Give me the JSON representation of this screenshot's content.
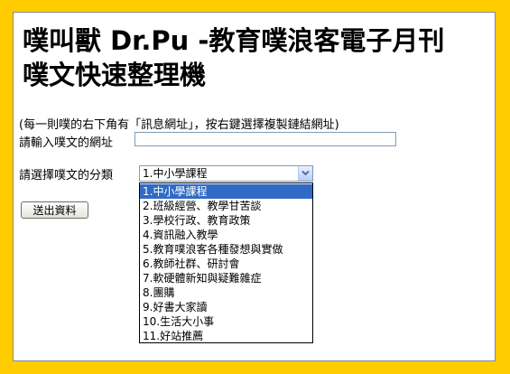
{
  "title": {
    "line1": "噗叫獸 Dr.Pu -教育噗浪客電子月刊",
    "line2": "噗文快速整理機"
  },
  "hint": "(每一則噗的右下角有「訊息網址」，按右鍵選擇複製鏈結網址)",
  "url_field": {
    "label": "請輸入噗文的網址",
    "value": ""
  },
  "category": {
    "label": "請選擇噗文的分類",
    "selected": "1.中小學課程",
    "options": [
      "1.中小學課程",
      "2.班級經營、教學甘苦談",
      "3.學校行政、教育政策",
      "4.資訊融入教學",
      "5.教育噗浪客各種發想與實做",
      "6.教師社群、研討會",
      "7.軟硬體新知與疑難雜症",
      "8.團購",
      "9.好書大家讀",
      "10.生活大小事",
      "11.好站推薦"
    ]
  },
  "submit_label": "送出資料",
  "colors": {
    "background": "#ffcc00",
    "panel": "#ffffff",
    "selection": "#316ac5"
  }
}
